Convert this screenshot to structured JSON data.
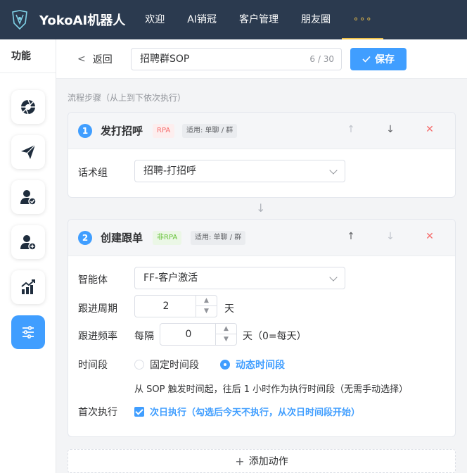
{
  "app": {
    "brand": "YokoAI机器人"
  },
  "nav": {
    "items": [
      "欢迎",
      "AI销冠",
      "客户管理",
      "朋友圈"
    ],
    "more": "∘∘∘"
  },
  "sidebar": {
    "title": "功能"
  },
  "header": {
    "back_label": "返回",
    "name_value": "招聘群SOP",
    "name_count": "6 / 30",
    "save_label": "保存"
  },
  "section_caption": "流程步骤（从上到下依次执行）",
  "steps": [
    {
      "number": "1",
      "title": "发打招呼",
      "tag": "RPA",
      "scope": "适用: 单聊 / 群",
      "fields": {
        "script_label": "话术组",
        "script_value": "招聘-打招呼"
      }
    },
    {
      "number": "2",
      "title": "创建跟单",
      "tag": "非RPA",
      "scope": "适用: 单聊 / 群",
      "fields": {
        "agent_label": "智能体",
        "agent_value": "FF-客户激活",
        "cycle_label": "跟进周期",
        "cycle_value": "2",
        "cycle_unit": "天",
        "freq_label": "跟进频率",
        "freq_prefix": "每隔",
        "freq_value": "0",
        "freq_unit": "天（0=每天）",
        "period_label": "时间段",
        "period_fixed": "固定时间段",
        "period_dynamic": "动态时间段",
        "period_hint": "从 SOP 触发时间起，往后 1 小时作为执行时间段（无需手动选择）",
        "first_label": "首次执行",
        "first_checkbox": "次日执行（勾选后今天不执行，从次日时间段开始）"
      }
    }
  ],
  "add_action_label": "添加动作",
  "colors": {
    "primary": "#409eff",
    "topbar": "#2b3a4f",
    "accent": "#f0c24b",
    "danger": "#f56c6c",
    "success": "#67c23a"
  }
}
